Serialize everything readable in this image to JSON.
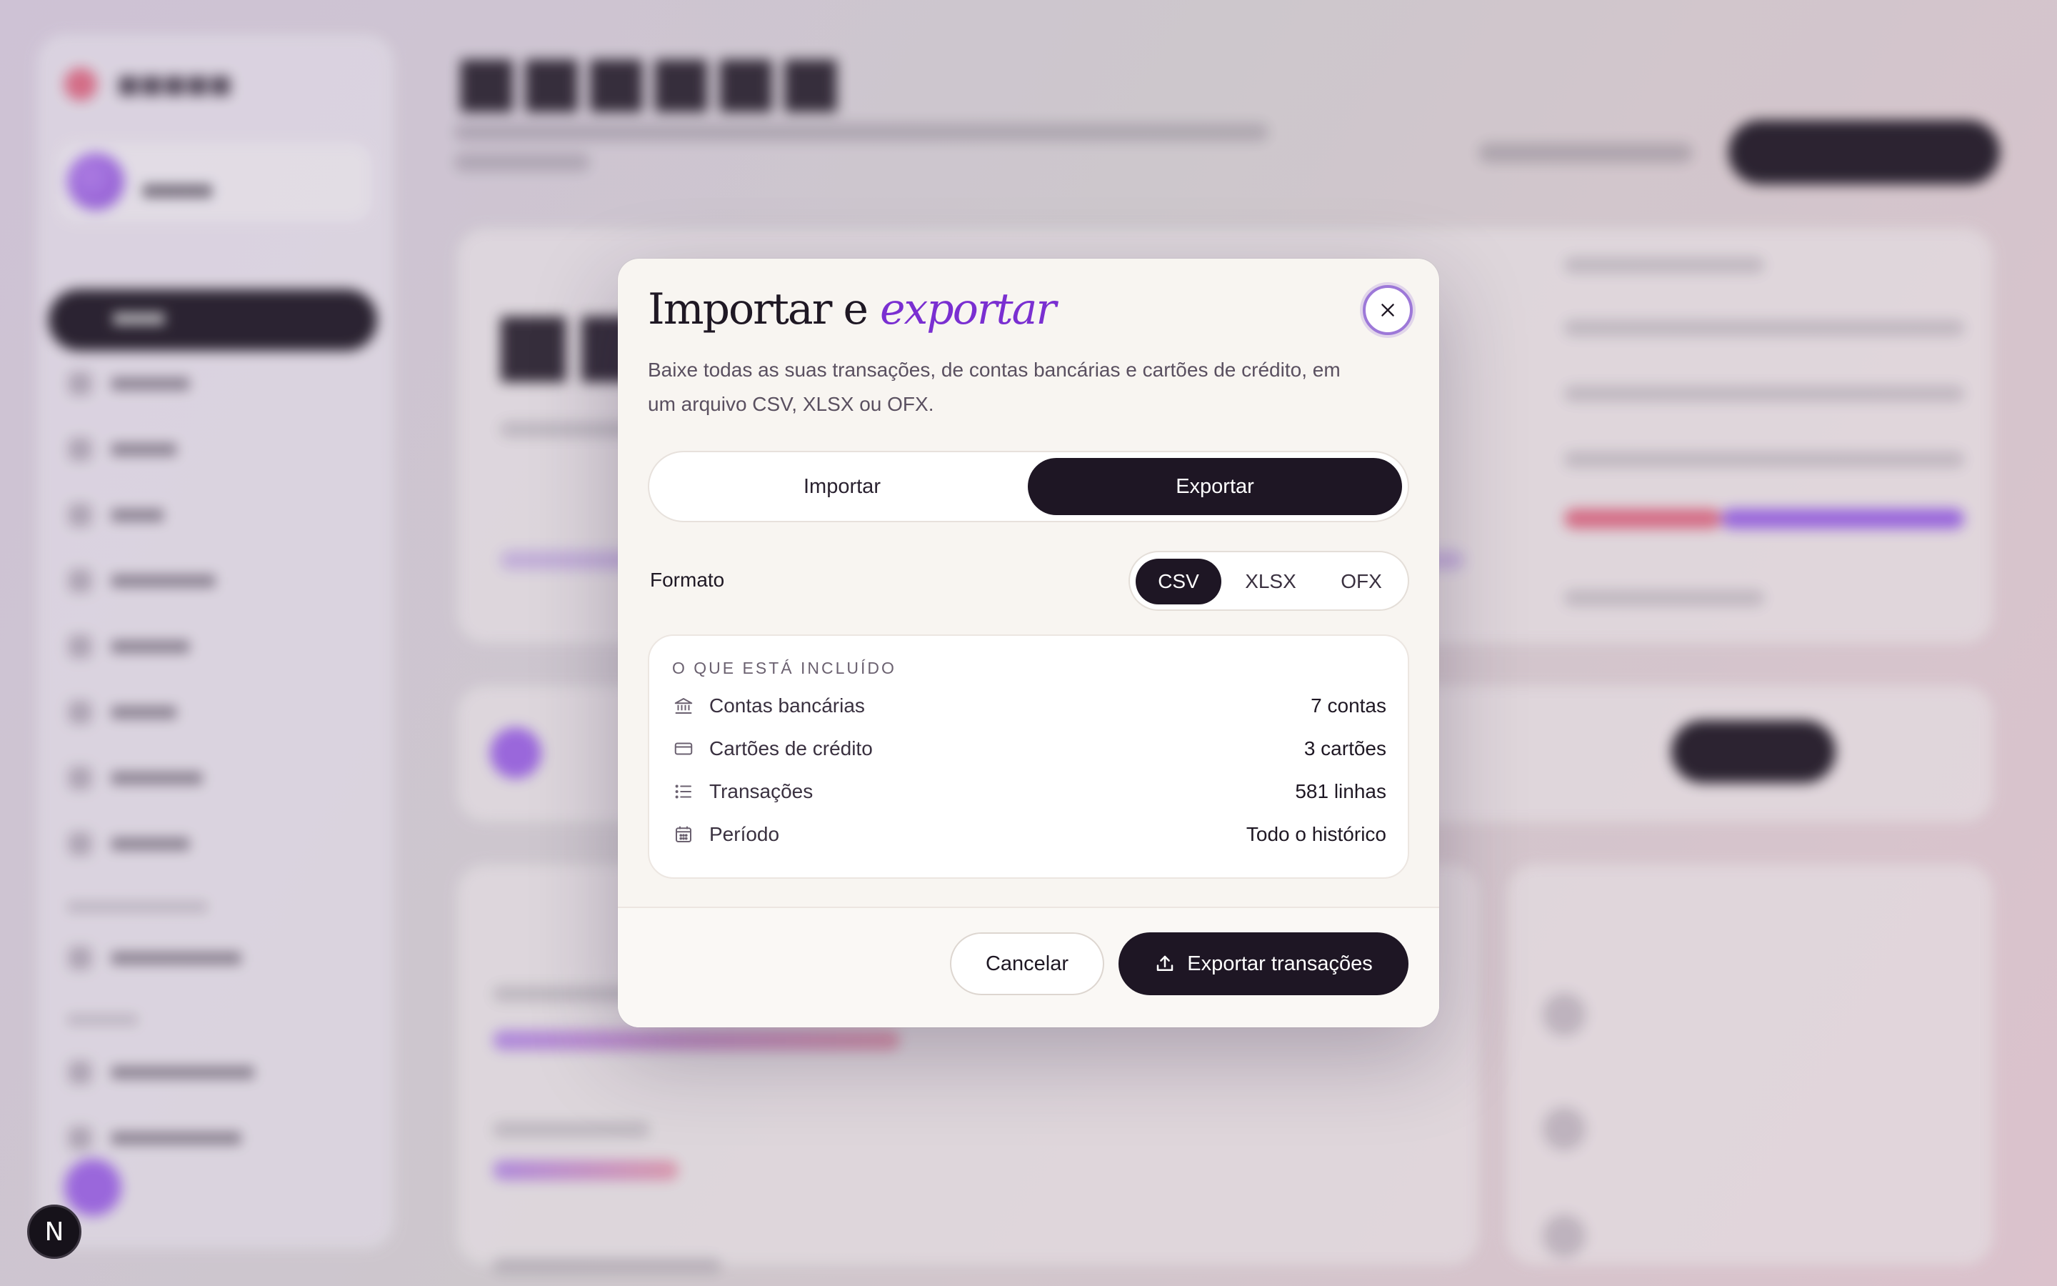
{
  "modal": {
    "title_main": "Importar e",
    "title_accent": "exportar",
    "description": "Baixe todas as suas transações, de contas bancárias e cartões de crédito, em um arquivo CSV, XLSX ou OFX.",
    "tabs": [
      {
        "label": "Importar",
        "selected": false
      },
      {
        "label": "Exportar",
        "selected": true
      }
    ],
    "format": {
      "label": "Formato",
      "options": [
        "CSV",
        "XLSX",
        "OFX"
      ],
      "selected": "CSV"
    },
    "included": {
      "heading": "O QUE ESTÁ INCLUÍDO",
      "rows": [
        {
          "icon": "bank-icon",
          "label": "Contas bancárias",
          "value": "7 contas"
        },
        {
          "icon": "credit-card-icon",
          "label": "Cartões de crédito",
          "value": "3 cartões"
        },
        {
          "icon": "list-icon",
          "label": "Transações",
          "value": "581 linhas"
        },
        {
          "icon": "calendar-icon",
          "label": "Período",
          "value": "Todo o histórico"
        }
      ]
    },
    "buttons": {
      "cancel": "Cancelar",
      "export": "Exportar transações"
    }
  },
  "badge": {
    "label": "N"
  },
  "colors": {
    "accent": "#7a2fd1",
    "dark": "#1e1624",
    "modal_bg": "#f8f5f1"
  }
}
